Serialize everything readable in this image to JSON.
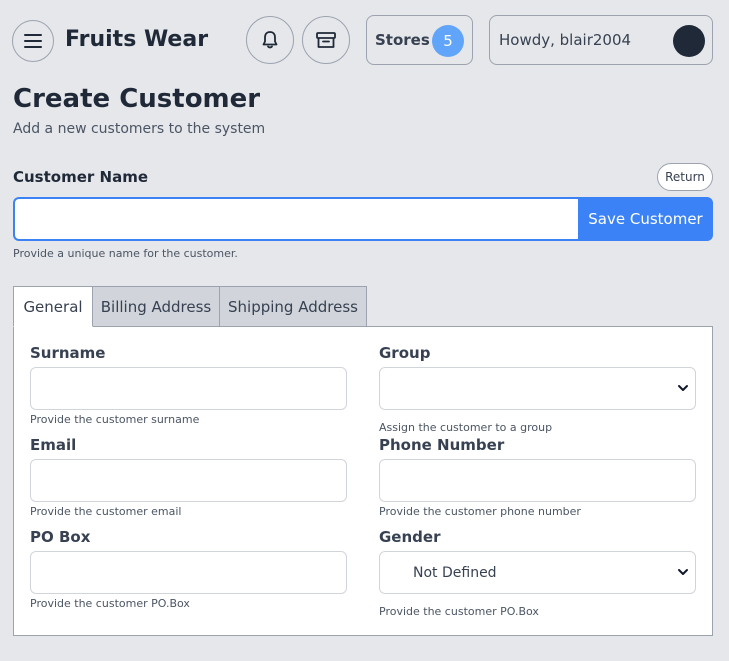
{
  "header": {
    "brand": "Fruits Wear",
    "stores_label": "Stores",
    "stores_count": "5",
    "greeting": "Howdy, blair2004"
  },
  "page": {
    "title": "Create Customer",
    "subtitle": "Add a new customers to the system"
  },
  "customer_name": {
    "label": "Customer Name",
    "value": "",
    "help": "Provide a unique name for the customer.",
    "save_label": "Save Customer",
    "return_label": "Return"
  },
  "tabs": [
    {
      "label": "General",
      "active": true
    },
    {
      "label": "Billing Address",
      "active": false
    },
    {
      "label": "Shipping Address",
      "active": false
    }
  ],
  "form": {
    "surname": {
      "label": "Surname",
      "value": "",
      "help": "Provide the customer surname"
    },
    "group": {
      "label": "Group",
      "value": "",
      "help": "Assign the customer to a group"
    },
    "email": {
      "label": "Email",
      "value": "",
      "help": "Provide the customer email"
    },
    "phone": {
      "label": "Phone Number",
      "value": "",
      "help": "Provide the customer phone number"
    },
    "pobox": {
      "label": "PO Box",
      "value": "",
      "help": "Provide the customer PO.Box"
    },
    "gender": {
      "label": "Gender",
      "value": "Not Defined",
      "help": "Provide the customer PO.Box"
    }
  },
  "icons": {
    "menu": "hamburger-menu-icon",
    "notifications": "bell-icon",
    "store": "store-icon",
    "chevron": "chevron-down-icon"
  },
  "colors": {
    "primary": "#3b82f6",
    "badge": "#60a5fa",
    "background": "#e5e7eb",
    "avatar": "#1f2937"
  }
}
